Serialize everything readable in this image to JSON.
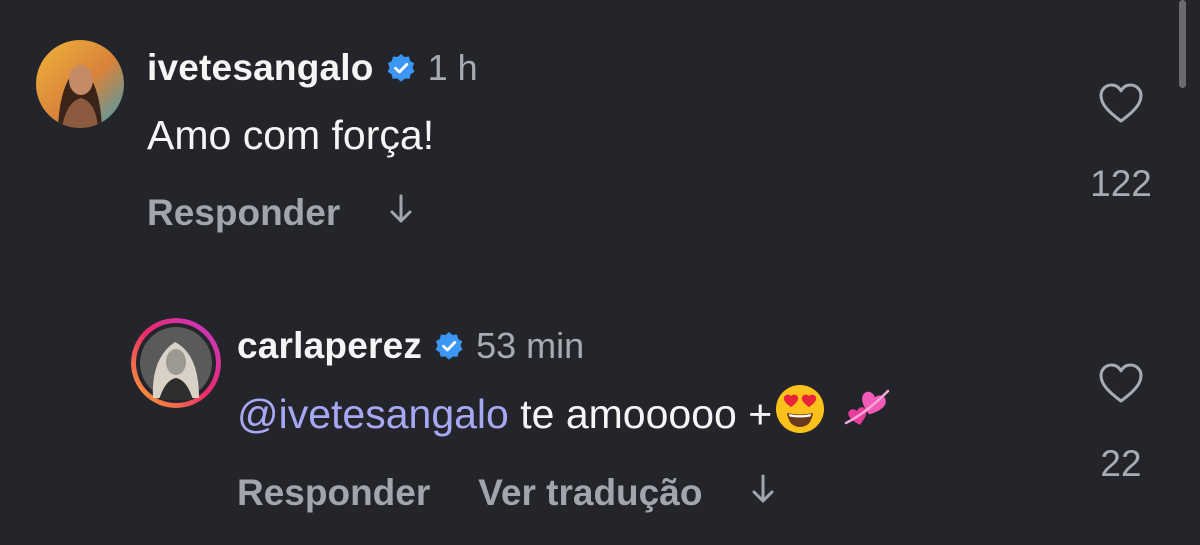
{
  "comments": [
    {
      "username": "ivetesangalo",
      "time": "1 h",
      "text": "Amo com força!",
      "actions": [
        "Responder"
      ],
      "likes": "122"
    },
    {
      "username": "carlaperez",
      "time": "53 min",
      "mention": "@ivetesangalo",
      "text": "te amooooo +",
      "emojis": [
        "heart-eyes-emoji",
        "revolving-hearts-emoji"
      ],
      "actions": [
        "Responder",
        "Ver tradução"
      ],
      "likes": "22"
    }
  ],
  "colors": {
    "background": "#24252a",
    "verified": "#3b97f3",
    "mention": "#a7a8f4",
    "muted": "#a9abb2"
  },
  "icons": [
    "verified-badge-icon",
    "heart-outline-icon",
    "arrow-down-icon"
  ]
}
